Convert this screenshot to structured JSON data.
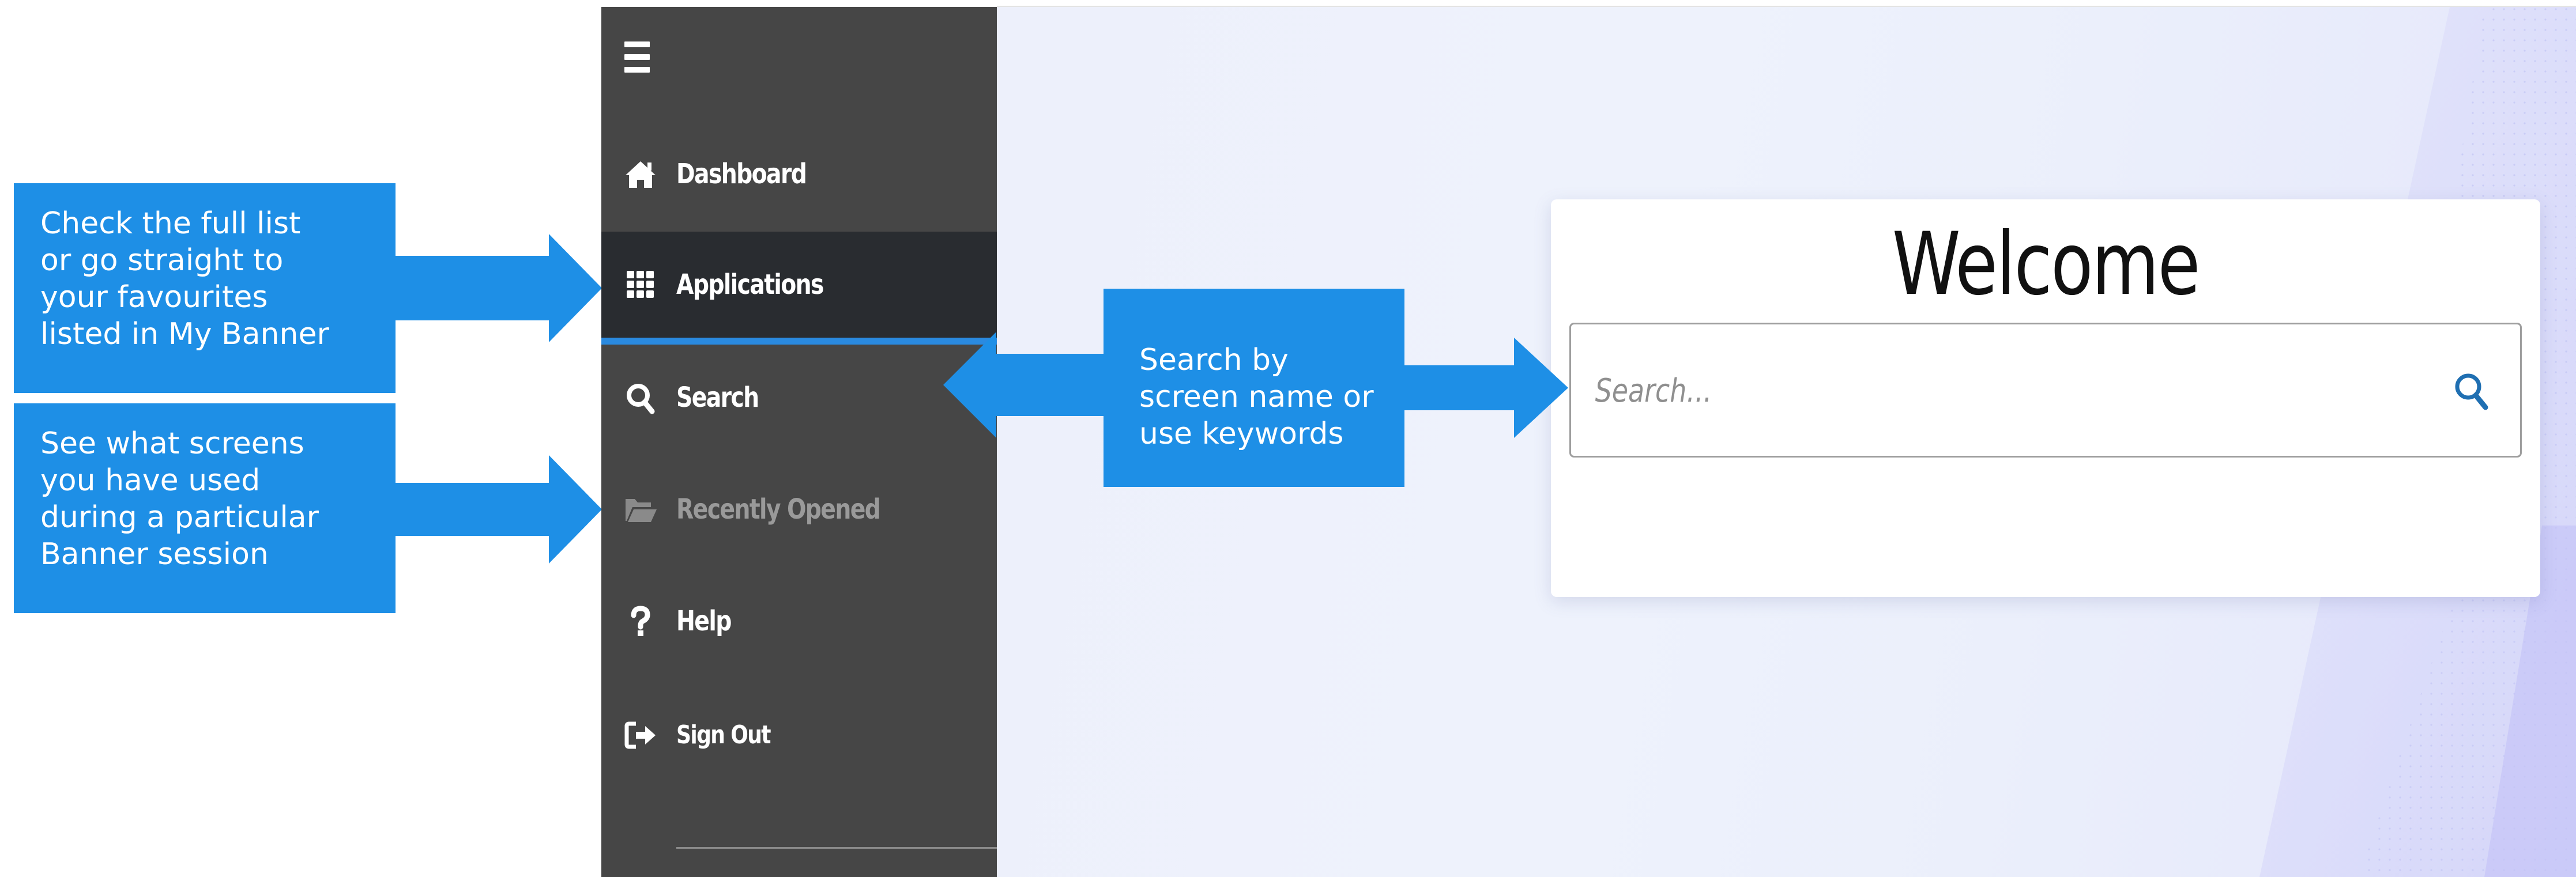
{
  "callouts": {
    "applications_note": [
      "Check the full list",
      "or go straight to",
      "your favourites",
      "listed in My Banner"
    ],
    "recent_note": [
      "See what screens",
      "you have used",
      "during a particular",
      "Banner session"
    ],
    "search_note": [
      "Search by",
      "screen name or",
      "use keywords"
    ]
  },
  "sidebar": {
    "items": [
      {
        "label": "Dashboard",
        "icon": "home-icon"
      },
      {
        "label": "Applications",
        "icon": "grid-icon",
        "active": true
      },
      {
        "label": "Search",
        "icon": "search-icon"
      },
      {
        "label": "Recently Opened",
        "icon": "folder-open-icon",
        "disabled": true
      },
      {
        "label": "Help",
        "icon": "question-icon"
      },
      {
        "label": "Sign Out",
        "icon": "sign-out-icon"
      }
    ]
  },
  "main": {
    "welcome_title": "Welcome",
    "search": {
      "placeholder": "Search..."
    }
  },
  "colors": {
    "callout_blue": "#1e8fe6",
    "sidebar_bg": "#464646",
    "active_item_bg": "#292c30",
    "active_underline": "#2a8ae0",
    "search_icon": "#1f6fb2"
  }
}
